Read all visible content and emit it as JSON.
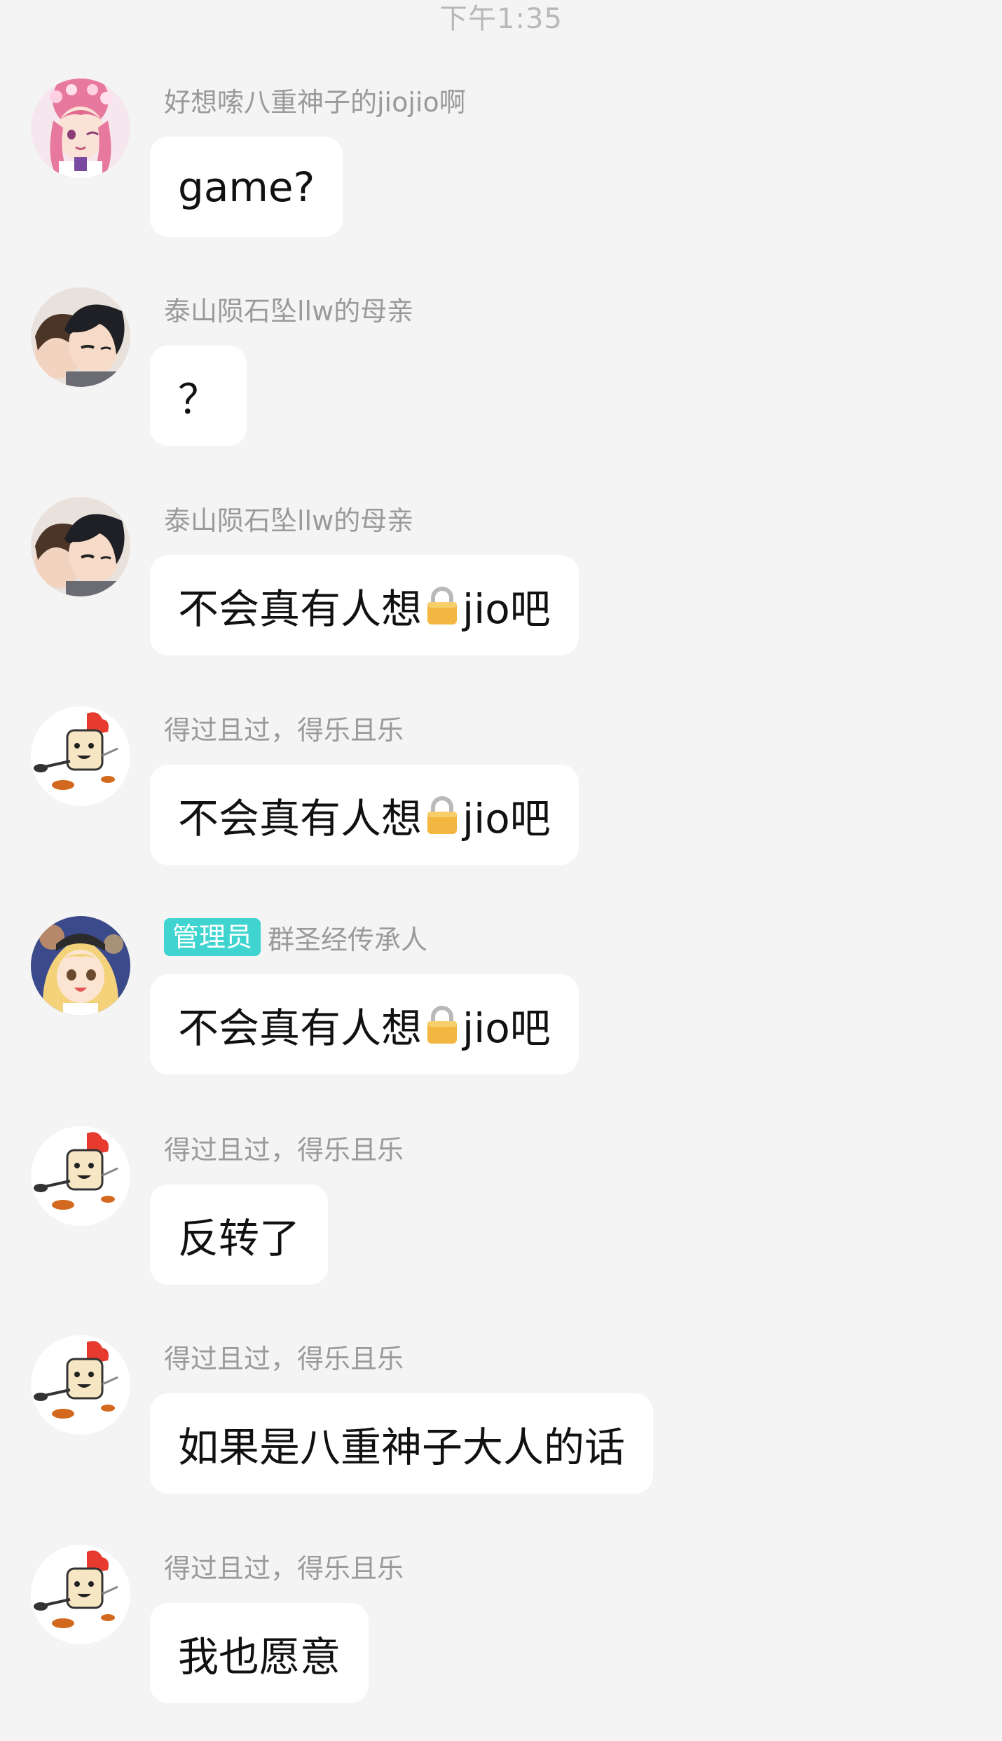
{
  "timestamp": "下午1:35",
  "messages": [
    {
      "sender": "好想嗦八重神子的jiojio啊",
      "avatar_icon": "pink-hair-anime-girl-avatar",
      "text": "game?"
    },
    {
      "sender": "泰山陨石坠llw的母亲",
      "avatar_icon": "dark-hair-anime-boy-avatar",
      "text": "？"
    },
    {
      "sender": "泰山陨石坠llw的母亲",
      "avatar_icon": "dark-hair-anime-boy-avatar",
      "text_before": "不会真有人想",
      "inline_icon": "lock-emoji",
      "text_after": "jio吧"
    },
    {
      "sender": "得过且过，得乐且乐",
      "avatar_icon": "toast-chef-cartoon-avatar",
      "text_before": "不会真有人想",
      "inline_icon": "lock-emoji",
      "text_after": "jio吧"
    },
    {
      "badge": "管理员",
      "sender": "群圣经传承人",
      "avatar_icon": "blonde-anime-girl-avatar",
      "text_before": "不会真有人想",
      "inline_icon": "lock-emoji",
      "text_after": "jio吧"
    },
    {
      "sender": "得过且过，得乐且乐",
      "avatar_icon": "toast-chef-cartoon-avatar",
      "text": "反转了"
    },
    {
      "sender": "得过且过，得乐且乐",
      "avatar_icon": "toast-chef-cartoon-avatar",
      "text": "如果是八重神子大人的话"
    },
    {
      "sender": "得过且过，得乐且乐",
      "avatar_icon": "toast-chef-cartoon-avatar",
      "text": "我也愿意"
    }
  ],
  "colors": {
    "background": "#f4f4f4",
    "bubble": "#ffffff",
    "sender_text": "#9a9a9a",
    "admin_badge": "#3fd4d0"
  }
}
